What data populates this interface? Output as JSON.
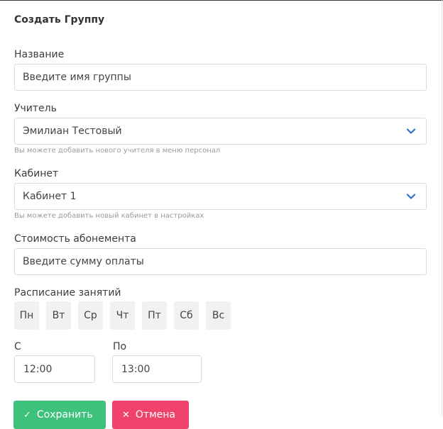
{
  "form": {
    "title": "Создать Группу",
    "name": {
      "label": "Название",
      "placeholder": "Введите имя группы"
    },
    "teacher": {
      "label": "Учитель",
      "value": "Эмилиан Тестовый",
      "hint": "Вы можете добавить нового учителя в меню персонал"
    },
    "room": {
      "label": "Кабинет",
      "value": "Кабинет 1",
      "hint": "Вы можете добавить новый кабинет в настройках"
    },
    "price": {
      "label": "Стоимость абонемента",
      "placeholder": "Введите сумму оплаты"
    },
    "schedule": {
      "label": "Расписание занятий",
      "days": [
        "Пн",
        "Вт",
        "Ср",
        "Чт",
        "Пт",
        "Сб",
        "Вс"
      ]
    },
    "from": {
      "label": "С",
      "value": "12:00"
    },
    "to": {
      "label": "По",
      "value": "13:00"
    },
    "buttons": {
      "save": "Сохранить",
      "cancel": "Отмена"
    }
  },
  "colors": {
    "save": "#3ec17b",
    "cancel": "#f0436b",
    "chevron": "#2f6fd1"
  }
}
